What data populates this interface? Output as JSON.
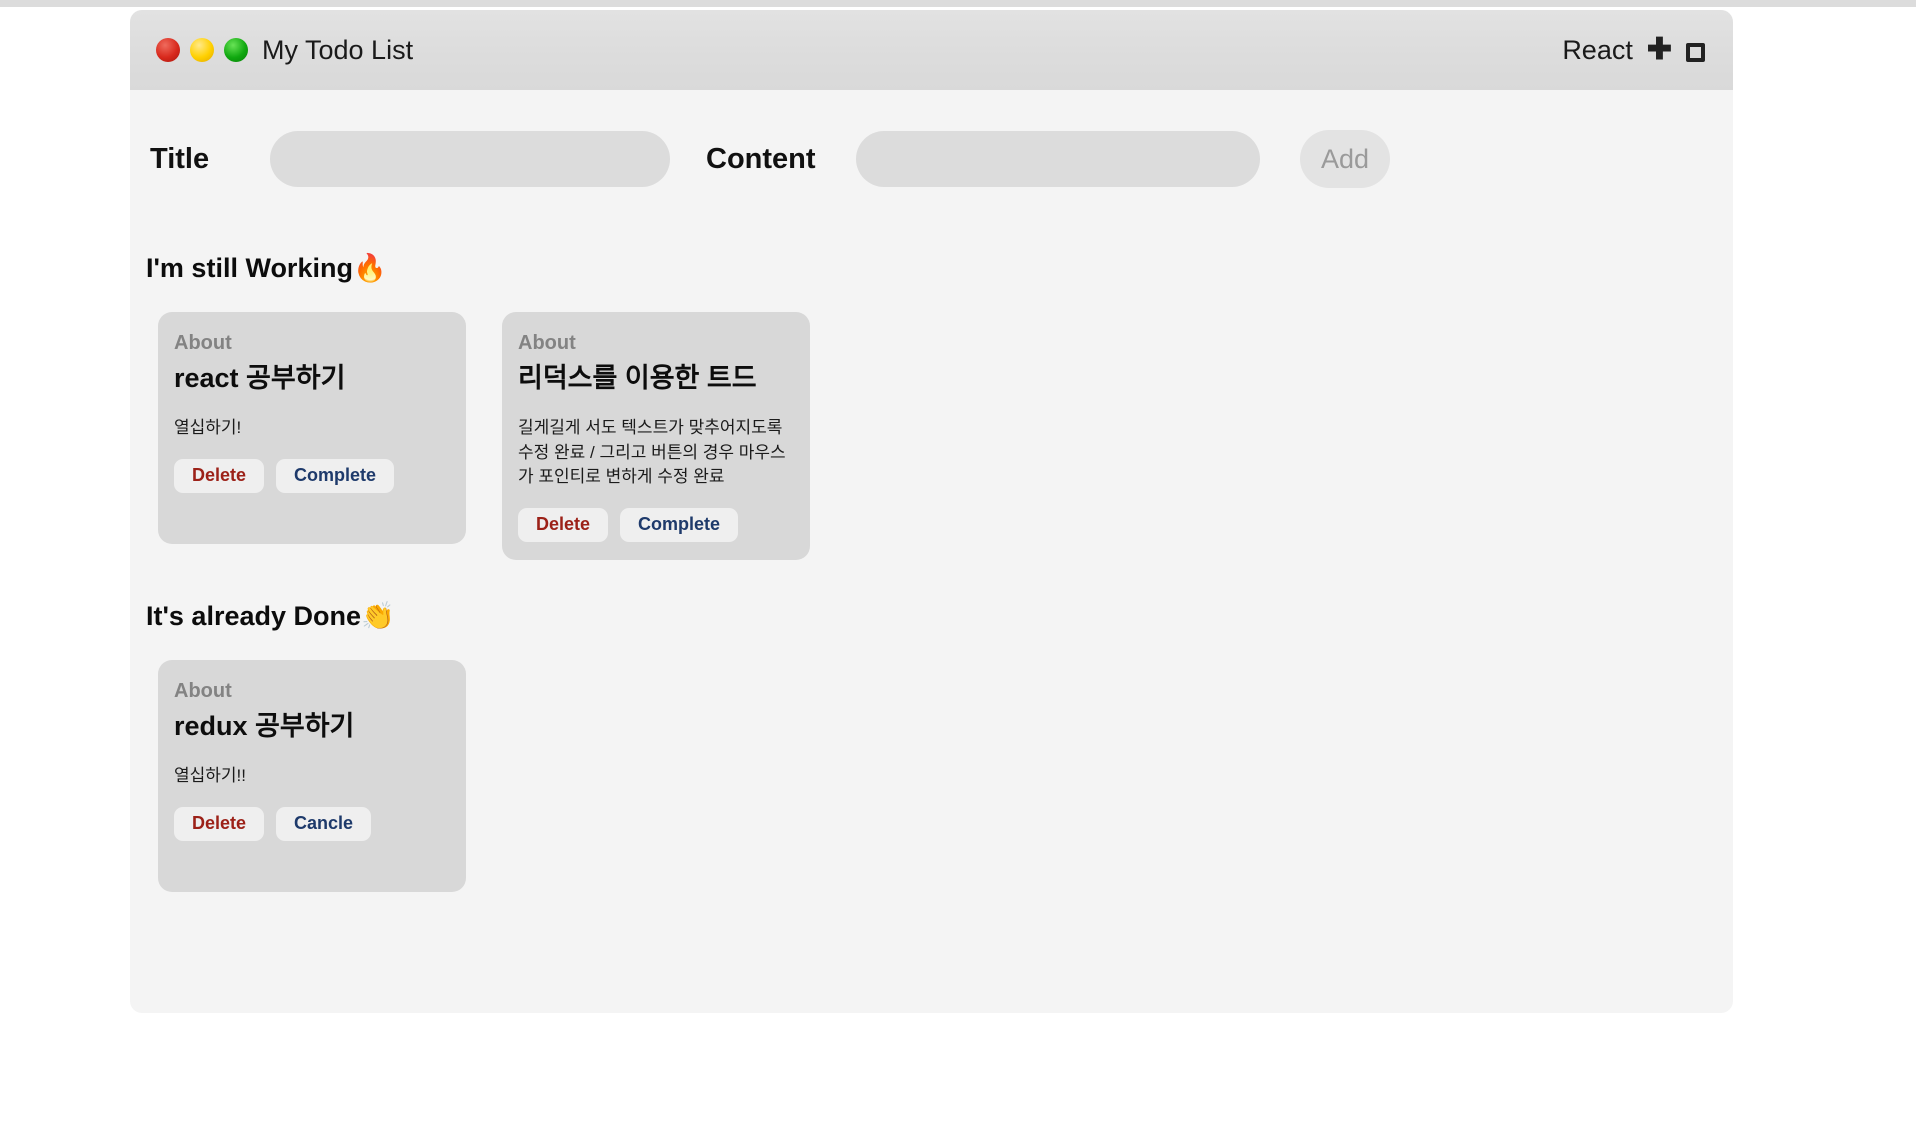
{
  "browser": {
    "top_strip_color": "#dcdcdc",
    "page_background": "#ffffff"
  },
  "window": {
    "title": "My Todo List",
    "titlebar_color": "#dedede",
    "body_color": "#f4f4f4",
    "traffic_lights": [
      {
        "name": "close",
        "color": "#d8291c"
      },
      {
        "name": "minimize",
        "color": "#ffd000"
      },
      {
        "name": "maximize",
        "color": "#10a810"
      }
    ],
    "right_controls": {
      "app_label": "React",
      "plus_glyph": "✚",
      "window_glyph": "square-icon"
    }
  },
  "form": {
    "title_label": "Title",
    "title_value": "",
    "title_placeholder": "",
    "content_label": "Content",
    "content_value": "",
    "content_placeholder": "",
    "add_label": "Add",
    "add_disabled_color": "#9a9a9a",
    "input_color": "#dcdcdc"
  },
  "sections": [
    {
      "id": "working",
      "heading": "I'm still Working🔥",
      "cards": [
        {
          "about": "About",
          "title": "react 공부하기",
          "body": "열십하기!",
          "buttons": [
            {
              "label": "Delete",
              "kind": "delete"
            },
            {
              "label": "Complete",
              "kind": "positive"
            }
          ]
        },
        {
          "about": "About",
          "title": "리덕스를 이용한 트드",
          "body": "길게길게 서도 텍스트가 맞추어지도록 수정 완료 / 그리고 버튼의 경우 마우스가 포인티로 변하게 수정 완료",
          "buttons": [
            {
              "label": "Delete",
              "kind": "delete"
            },
            {
              "label": "Complete",
              "kind": "positive"
            }
          ]
        }
      ]
    },
    {
      "id": "done",
      "heading": "It's already Done👏",
      "cards": [
        {
          "about": "About",
          "title": "redux 공부하기",
          "body": "열십하기!!",
          "buttons": [
            {
              "label": "Delete",
              "kind": "delete"
            },
            {
              "label": "Cancle",
              "kind": "positive"
            }
          ]
        }
      ]
    }
  ],
  "colors": {
    "card_background": "#d8d8d8",
    "card_button_background": "#efefef",
    "delete_text": "#9c2118",
    "positive_text": "#1e3a6b",
    "about_text": "#838383"
  }
}
